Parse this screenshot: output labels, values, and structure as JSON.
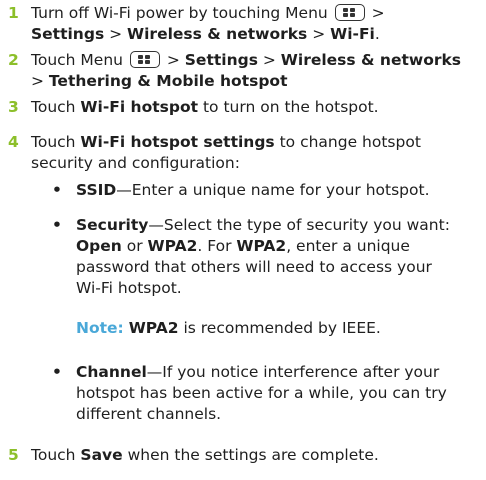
{
  "steps": [
    {
      "number": "1",
      "line1_prefix": "Turn off Wi-Fi power by touching Menu",
      "line1_suffix": " >",
      "line2_a": "Settings",
      "line2_sep1": " > ",
      "line2_b": "Wireless & networks",
      "line2_sep2": " > ",
      "line2_c": "Wi-Fi",
      "line2_end": "."
    },
    {
      "number": "2",
      "line1_prefix": "Touch Menu",
      "line1_sep1": " > ",
      "line1_a": "Settings",
      "line1_sep2": " > ",
      "line1_b": "Wireless & networks",
      "line2_sep": "> ",
      "line2_a": "Tethering & Mobile hotspot"
    },
    {
      "number": "3",
      "prefix": "Touch ",
      "bold": "Wi-Fi hotspot",
      "suffix": " to turn on the hotspot."
    },
    {
      "number": "4",
      "prefix": "Touch ",
      "bold": "Wi-Fi hotspot settings",
      "suffix_l1": " to change hotspot",
      "line2": "security and configuration:"
    },
    {
      "number": "5",
      "prefix": "Touch ",
      "bold": "Save",
      "suffix": " when the settings are complete."
    }
  ],
  "bullets": [
    {
      "term": "SSID",
      "text": "—Enter a unique name for your hotspot."
    },
    {
      "term": "Security",
      "l1": "—Select the type of security you want:",
      "l2_bold1": "Open",
      "l2_mid": " or ",
      "l2_bold2": "WPA2",
      "l2_mid2": ". For ",
      "l2_bold3": "WPA2",
      "l2_end": ", enter a unique",
      "l3": "password that others will need to access your",
      "l4": "Wi-Fi hotspot."
    },
    {
      "term": "Channel",
      "l1": "—If you notice interference after your",
      "l2": "hotspot has been active for a while, you can try",
      "l3": "different channels."
    }
  ],
  "note": {
    "label": "Note:",
    "bold": "WPA2",
    "text": " is recommended by IEEE."
  },
  "bullet_glyph": "•",
  "colors": {
    "step_number": "#8cbf2a",
    "note_label": "#4aa8d8"
  },
  "icons": {
    "menu_key": "menu-key-icon"
  }
}
